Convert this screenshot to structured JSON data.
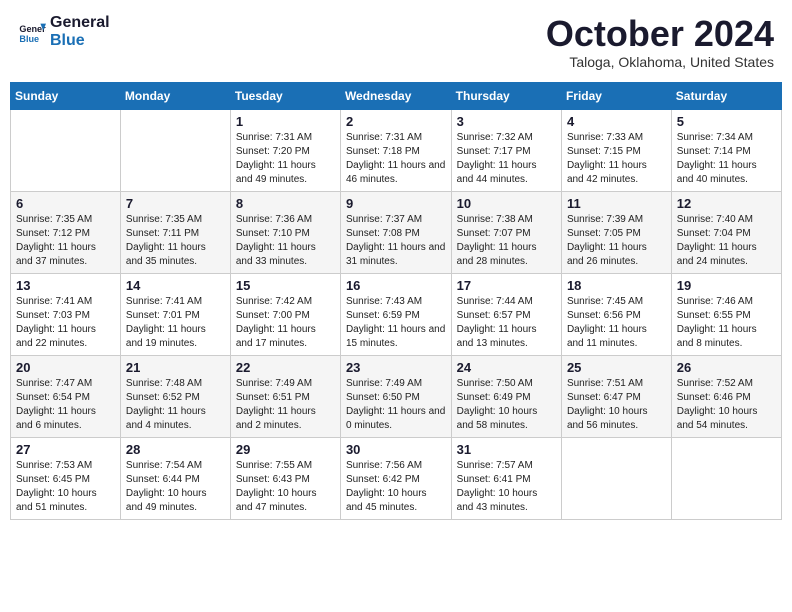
{
  "header": {
    "logo_line1": "General",
    "logo_line2": "Blue",
    "month": "October 2024",
    "location": "Taloga, Oklahoma, United States"
  },
  "days_of_week": [
    "Sunday",
    "Monday",
    "Tuesday",
    "Wednesday",
    "Thursday",
    "Friday",
    "Saturday"
  ],
  "weeks": [
    [
      {
        "day": "",
        "info": ""
      },
      {
        "day": "",
        "info": ""
      },
      {
        "day": "1",
        "info": "Sunrise: 7:31 AM\nSunset: 7:20 PM\nDaylight: 11 hours and 49 minutes."
      },
      {
        "day": "2",
        "info": "Sunrise: 7:31 AM\nSunset: 7:18 PM\nDaylight: 11 hours and 46 minutes."
      },
      {
        "day": "3",
        "info": "Sunrise: 7:32 AM\nSunset: 7:17 PM\nDaylight: 11 hours and 44 minutes."
      },
      {
        "day": "4",
        "info": "Sunrise: 7:33 AM\nSunset: 7:15 PM\nDaylight: 11 hours and 42 minutes."
      },
      {
        "day": "5",
        "info": "Sunrise: 7:34 AM\nSunset: 7:14 PM\nDaylight: 11 hours and 40 minutes."
      }
    ],
    [
      {
        "day": "6",
        "info": "Sunrise: 7:35 AM\nSunset: 7:12 PM\nDaylight: 11 hours and 37 minutes."
      },
      {
        "day": "7",
        "info": "Sunrise: 7:35 AM\nSunset: 7:11 PM\nDaylight: 11 hours and 35 minutes."
      },
      {
        "day": "8",
        "info": "Sunrise: 7:36 AM\nSunset: 7:10 PM\nDaylight: 11 hours and 33 minutes."
      },
      {
        "day": "9",
        "info": "Sunrise: 7:37 AM\nSunset: 7:08 PM\nDaylight: 11 hours and 31 minutes."
      },
      {
        "day": "10",
        "info": "Sunrise: 7:38 AM\nSunset: 7:07 PM\nDaylight: 11 hours and 28 minutes."
      },
      {
        "day": "11",
        "info": "Sunrise: 7:39 AM\nSunset: 7:05 PM\nDaylight: 11 hours and 26 minutes."
      },
      {
        "day": "12",
        "info": "Sunrise: 7:40 AM\nSunset: 7:04 PM\nDaylight: 11 hours and 24 minutes."
      }
    ],
    [
      {
        "day": "13",
        "info": "Sunrise: 7:41 AM\nSunset: 7:03 PM\nDaylight: 11 hours and 22 minutes."
      },
      {
        "day": "14",
        "info": "Sunrise: 7:41 AM\nSunset: 7:01 PM\nDaylight: 11 hours and 19 minutes."
      },
      {
        "day": "15",
        "info": "Sunrise: 7:42 AM\nSunset: 7:00 PM\nDaylight: 11 hours and 17 minutes."
      },
      {
        "day": "16",
        "info": "Sunrise: 7:43 AM\nSunset: 6:59 PM\nDaylight: 11 hours and 15 minutes."
      },
      {
        "day": "17",
        "info": "Sunrise: 7:44 AM\nSunset: 6:57 PM\nDaylight: 11 hours and 13 minutes."
      },
      {
        "day": "18",
        "info": "Sunrise: 7:45 AM\nSunset: 6:56 PM\nDaylight: 11 hours and 11 minutes."
      },
      {
        "day": "19",
        "info": "Sunrise: 7:46 AM\nSunset: 6:55 PM\nDaylight: 11 hours and 8 minutes."
      }
    ],
    [
      {
        "day": "20",
        "info": "Sunrise: 7:47 AM\nSunset: 6:54 PM\nDaylight: 11 hours and 6 minutes."
      },
      {
        "day": "21",
        "info": "Sunrise: 7:48 AM\nSunset: 6:52 PM\nDaylight: 11 hours and 4 minutes."
      },
      {
        "day": "22",
        "info": "Sunrise: 7:49 AM\nSunset: 6:51 PM\nDaylight: 11 hours and 2 minutes."
      },
      {
        "day": "23",
        "info": "Sunrise: 7:49 AM\nSunset: 6:50 PM\nDaylight: 11 hours and 0 minutes."
      },
      {
        "day": "24",
        "info": "Sunrise: 7:50 AM\nSunset: 6:49 PM\nDaylight: 10 hours and 58 minutes."
      },
      {
        "day": "25",
        "info": "Sunrise: 7:51 AM\nSunset: 6:47 PM\nDaylight: 10 hours and 56 minutes."
      },
      {
        "day": "26",
        "info": "Sunrise: 7:52 AM\nSunset: 6:46 PM\nDaylight: 10 hours and 54 minutes."
      }
    ],
    [
      {
        "day": "27",
        "info": "Sunrise: 7:53 AM\nSunset: 6:45 PM\nDaylight: 10 hours and 51 minutes."
      },
      {
        "day": "28",
        "info": "Sunrise: 7:54 AM\nSunset: 6:44 PM\nDaylight: 10 hours and 49 minutes."
      },
      {
        "day": "29",
        "info": "Sunrise: 7:55 AM\nSunset: 6:43 PM\nDaylight: 10 hours and 47 minutes."
      },
      {
        "day": "30",
        "info": "Sunrise: 7:56 AM\nSunset: 6:42 PM\nDaylight: 10 hours and 45 minutes."
      },
      {
        "day": "31",
        "info": "Sunrise: 7:57 AM\nSunset: 6:41 PM\nDaylight: 10 hours and 43 minutes."
      },
      {
        "day": "",
        "info": ""
      },
      {
        "day": "",
        "info": ""
      }
    ]
  ]
}
